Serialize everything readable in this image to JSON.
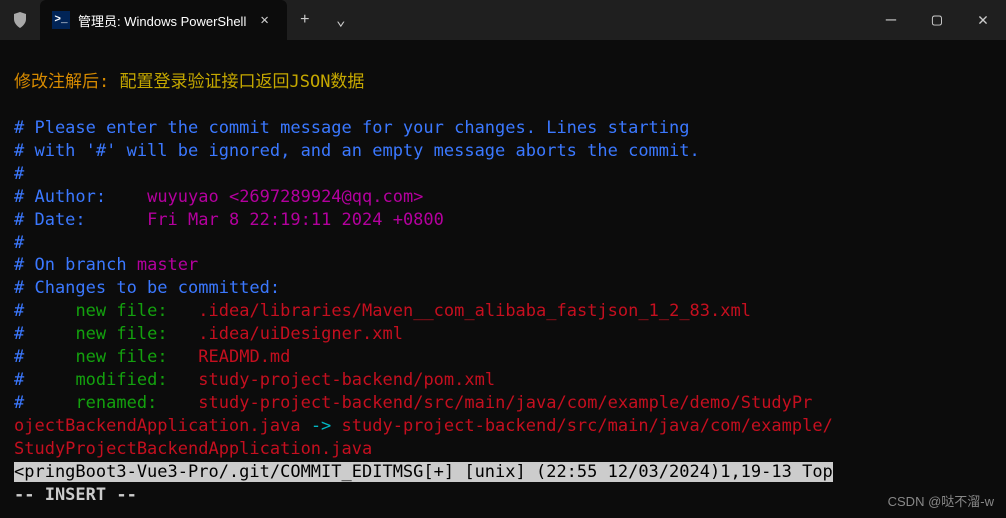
{
  "titlebar": {
    "tab_title": "管理员: Windows PowerShell",
    "close_glyph": "✕",
    "new_tab_glyph": "+",
    "dropdown_glyph": "⌄",
    "minimize_glyph": "—",
    "maximize_glyph": "▢",
    "win_close_glyph": "✕",
    "ps_glyph": ">_"
  },
  "editor": {
    "line1_label": "修改注解后: ",
    "line1_msg": "配置登录验证接口返回JSON数据",
    "comment1": "# Please enter the commit message for your changes. Lines starting",
    "comment2": "# with '#' will be ignored, and an empty message aborts the commit.",
    "hash": "#",
    "author_label": "# Author:",
    "author_value": "wuyuyao <2697289924@qq.com>",
    "date_label": "# Date:",
    "date_value": "Fri Mar 8 22:19:11 2024 +0800",
    "branch_label": "# On branch",
    "branch_name": "master",
    "changes_label": "# Changes to be committed:",
    "nf1_label": "new file:",
    "nf1_path": ".idea/libraries/Maven__com_alibaba_fastjson_1_2_83.xml",
    "nf2_label": "new file:",
    "nf2_path": ".idea/uiDesigner.xml",
    "nf3_label": "new file:",
    "nf3_path": "READMD.md",
    "mod_label": "modified:",
    "mod_path": "study-project-backend/pom.xml",
    "ren_label": "renamed:",
    "ren_from": "study-project-backend/src/main/java/com/example/demo/StudyPr",
    "ren_from2": "ojectBackendApplication.java",
    "ren_arrow": " -> ",
    "ren_to": "study-project-backend/src/main/java/com/example/",
    "ren_to2": "StudyProjectBackendApplication.java",
    "statusline": "<pringBoot3-Vue3-Pro/.git/COMMIT_EDITMSG[+] [unix] (22:55 12/03/2024)1,19-13 Top",
    "mode": "-- INSERT --"
  },
  "watermark": "CSDN @哒不溜-w"
}
